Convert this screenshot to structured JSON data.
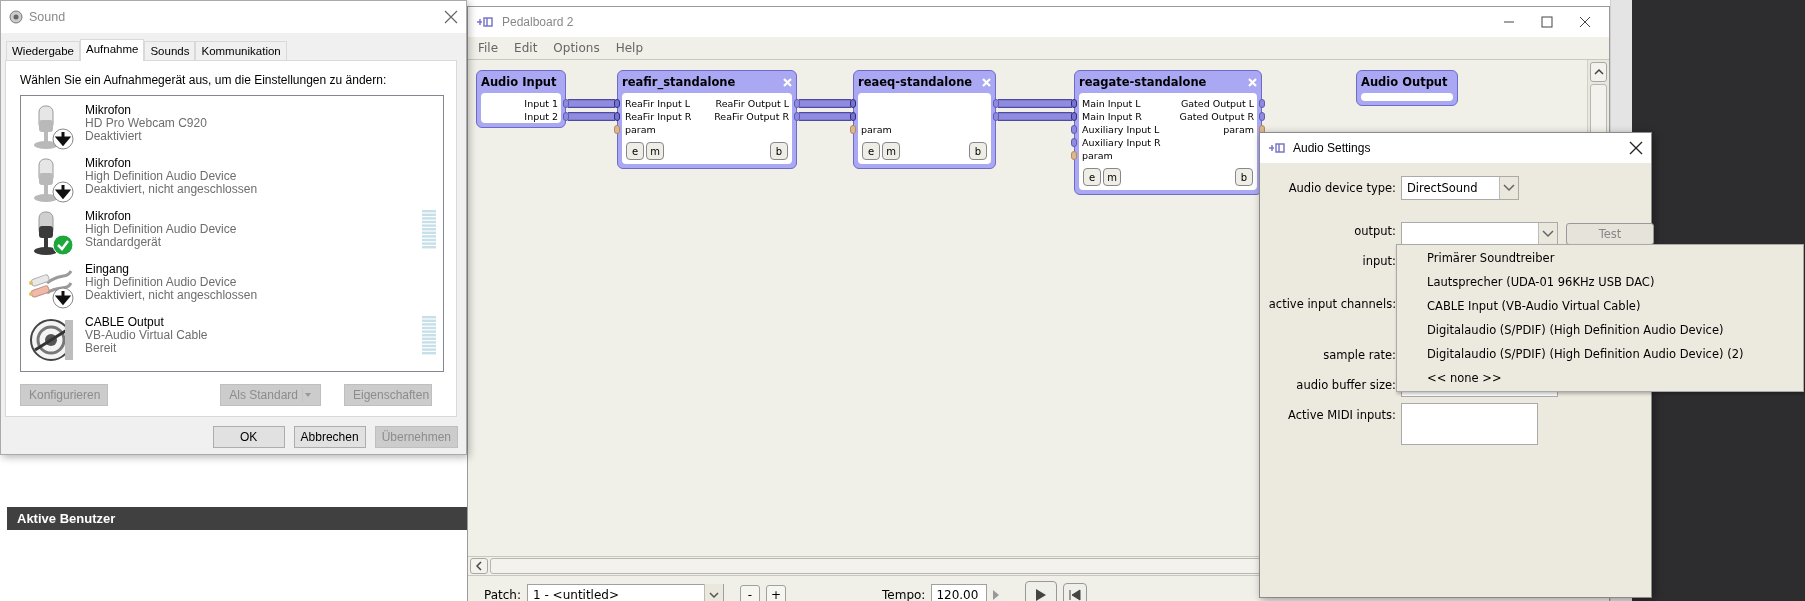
{
  "web_page": {
    "panel_title": "Aktive Benutzer"
  },
  "sound_dialog": {
    "title": "Sound",
    "tabs": [
      {
        "label": "Wiedergabe",
        "selected": false
      },
      {
        "label": "Aufnahme",
        "selected": true
      },
      {
        "label": "Sounds",
        "selected": false
      },
      {
        "label": "Kommunikation",
        "selected": false
      }
    ],
    "instruction": "Wählen Sie ein Aufnahmegerät aus, um die Einstellungen zu ändern:",
    "devices": [
      {
        "name": "Mikrofon",
        "device": "HD Pro Webcam C920",
        "status": "Deaktiviert",
        "kind": "microphone",
        "disabled": true,
        "default": false,
        "meter": false
      },
      {
        "name": "Mikrofon",
        "device": "High Definition Audio Device",
        "status": "Deaktiviert, nicht angeschlossen",
        "kind": "microphone",
        "disabled": true,
        "default": false,
        "meter": false
      },
      {
        "name": "Mikrofon",
        "device": "High Definition Audio Device",
        "status": "Standardgerät",
        "kind": "microphone",
        "disabled": false,
        "default": true,
        "meter": true
      },
      {
        "name": "Eingang",
        "device": "High Definition Audio Device",
        "status": "Deaktiviert, nicht angeschlossen",
        "kind": "plug",
        "disabled": true,
        "default": false,
        "meter": false
      },
      {
        "name": "CABLE Output",
        "device": "VB-Audio Virtual Cable",
        "status": "Bereit",
        "kind": "cable",
        "disabled": false,
        "default": false,
        "meter": true
      }
    ],
    "buttons": [
      {
        "label": "Konfigurieren",
        "disabled": true,
        "kind": "plain"
      },
      {
        "label": "Als Standard",
        "disabled": true,
        "kind": "split"
      },
      {
        "label": "Eigenschaften",
        "disabled": true,
        "kind": "plain"
      }
    ],
    "footer_buttons": [
      {
        "label": "OK",
        "disabled": false
      },
      {
        "label": "Abbrechen",
        "disabled": false
      },
      {
        "label": "Übernehmen",
        "disabled": true
      }
    ]
  },
  "pedalboard": {
    "title": "Pedalboard 2",
    "menu": [
      "File",
      "Edit",
      "Options",
      "Help"
    ],
    "nodes": [
      {
        "title": "Audio Input",
        "closable": false,
        "outputs": [
          {
            "label": "Input 1",
            "kind": "audio"
          },
          {
            "label": "Input 2",
            "kind": "audio"
          }
        ]
      },
      {
        "title": "reafir_standalone",
        "closable": true,
        "inputs": [
          {
            "label": "ReaFir Input L",
            "kind": "audio",
            "connected": true
          },
          {
            "label": "ReaFir Input R",
            "kind": "audio",
            "connected": true
          },
          {
            "label": "param",
            "kind": "param",
            "connected": false
          }
        ],
        "outputs": [
          {
            "label": "ReaFir Output L",
            "kind": "audio"
          },
          {
            "label": "ReaFir Output R",
            "kind": "audio"
          }
        ],
        "left_buttons": [
          "e",
          "m"
        ],
        "right_buttons": [
          "b"
        ]
      },
      {
        "title": "reaeq-standalone",
        "closable": true,
        "inputs": [
          {
            "kind": "audio",
            "connected": true
          },
          {
            "kind": "audio",
            "connected": true
          },
          {
            "label": "param",
            "kind": "param",
            "connected": false
          }
        ],
        "outputs": [
          {
            "kind": "audio"
          },
          {
            "kind": "audio"
          }
        ],
        "left_buttons": [
          "e",
          "m"
        ],
        "right_buttons": [
          "b"
        ]
      },
      {
        "title": "reagate-standalone",
        "closable": true,
        "inputs": [
          {
            "label": "Main Input L",
            "kind": "audio",
            "connected": true
          },
          {
            "label": "Main Input R",
            "kind": "audio",
            "connected": true
          },
          {
            "label": "Auxiliary Input L",
            "kind": "audio",
            "connected": false
          },
          {
            "label": "Auxiliary Input R",
            "kind": "audio",
            "connected": false
          },
          {
            "label": "param",
            "kind": "param",
            "connected": false
          }
        ],
        "outputs": [
          {
            "label": "Gated Output L",
            "kind": "audio"
          },
          {
            "label": "Gated Output R",
            "kind": "audio"
          },
          {
            "label": "param",
            "kind": "param"
          }
        ],
        "left_buttons": [
          "e",
          "m"
        ],
        "right_buttons": [
          "b"
        ]
      },
      {
        "title": "Audio Output",
        "closable": false
      }
    ],
    "patch_label": "Patch:",
    "patch": "1 - <untitled>",
    "patch_buttons": [
      "-",
      "+"
    ],
    "tempo_label": "Tempo:",
    "tempo": "120.00"
  },
  "audio_settings": {
    "title": "Audio Settings",
    "device_type_label": "Audio device type:",
    "device_type": "DirectSound",
    "output_label": "output:",
    "test_button": {
      "label": "Test",
      "disabled": true
    },
    "labels": [
      "input:",
      "active input channels:",
      "sample rate:",
      "audio buffer size:",
      "Active MIDI inputs:"
    ],
    "output_options": [
      {
        "label": "Primärer Soundtreiber",
        "selected": false
      },
      {
        "label": "Lautsprecher (UDA-01 96KHz USB DAC)",
        "selected": false
      },
      {
        "label": "CABLE Input (VB-Audio Virtual Cable)",
        "selected": false
      },
      {
        "label": "Digitalaudio (S/PDIF) (High Definition Audio Device)",
        "selected": false
      },
      {
        "label": "Digitalaudio (S/PDIF) (High Definition Audio Device) (2)",
        "selected": false
      },
      {
        "label": "<< none >>",
        "selected": false
      }
    ]
  }
}
